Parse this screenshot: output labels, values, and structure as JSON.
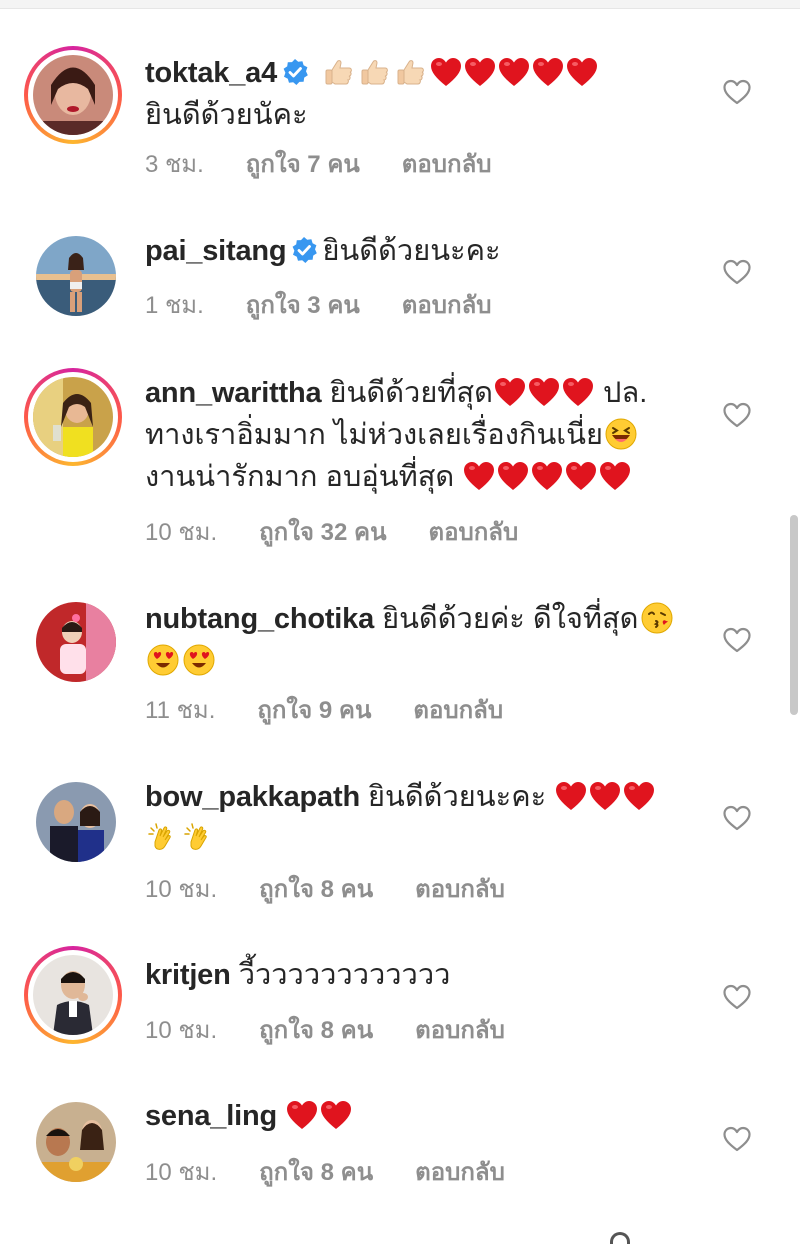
{
  "colors": {
    "meta_gray": "#8e8e8e",
    "text": "#262626",
    "verified_blue": "#3897f0",
    "heart_red": "#e0141e"
  },
  "comments": [
    {
      "username": "toktak_a4",
      "verified": true,
      "story_ring": true,
      "line1": "",
      "line2": "ยินดีด้วยนัคะ",
      "emojis": [
        "thumbs-up",
        "thumbs-up",
        "thumbs-up",
        "red-heart",
        "red-heart",
        "red-heart",
        "red-heart",
        "red-heart"
      ],
      "time": "3 ชม.",
      "likes": "ถูกใจ 7 คน",
      "reply": "ตอบกลับ"
    },
    {
      "username": "pai_sitang",
      "verified": true,
      "story_ring": false,
      "line1": "ยินดีด้วยนะคะ",
      "time": "1 ชม.",
      "likes": "ถูกใจ 3 คน",
      "reply": "ตอบกลับ"
    },
    {
      "username": "ann_warittha",
      "verified": false,
      "story_ring": true,
      "line1": "ยินดีด้วยที่สุด",
      "line1b": "ปล.",
      "line2": "ทางเราอิ่มมาก ไม่ห่วงเลยเรื่องกินเนี่ย",
      "line3": "งานน่ารักมาก อบอุ่นที่สุด",
      "time": "10 ชม.",
      "likes": "ถูกใจ 32 คน",
      "reply": "ตอบกลับ"
    },
    {
      "username": "nubtang_chotika",
      "verified": false,
      "story_ring": false,
      "line1": "ยินดีด้วยค่ะ ดีใจที่สุด",
      "time": "11 ชม.",
      "likes": "ถูกใจ 9 คน",
      "reply": "ตอบกลับ"
    },
    {
      "username": "bow_pakkapath",
      "verified": false,
      "story_ring": false,
      "line1": "ยินดีด้วยนะคะ",
      "time": "10 ชม.",
      "likes": "ถูกใจ 8 คน",
      "reply": "ตอบกลับ"
    },
    {
      "username": "kritjen",
      "verified": false,
      "story_ring": true,
      "line1": "วี้วววววววววววว",
      "time": "10 ชม.",
      "likes": "ถูกใจ 8 คน",
      "reply": "ตอบกลับ"
    },
    {
      "username": "sena_ling",
      "verified": false,
      "story_ring": false,
      "line1": "",
      "time": "10 ชม.",
      "likes": "ถูกใจ 8 คน",
      "reply": "ตอบกลับ"
    }
  ]
}
